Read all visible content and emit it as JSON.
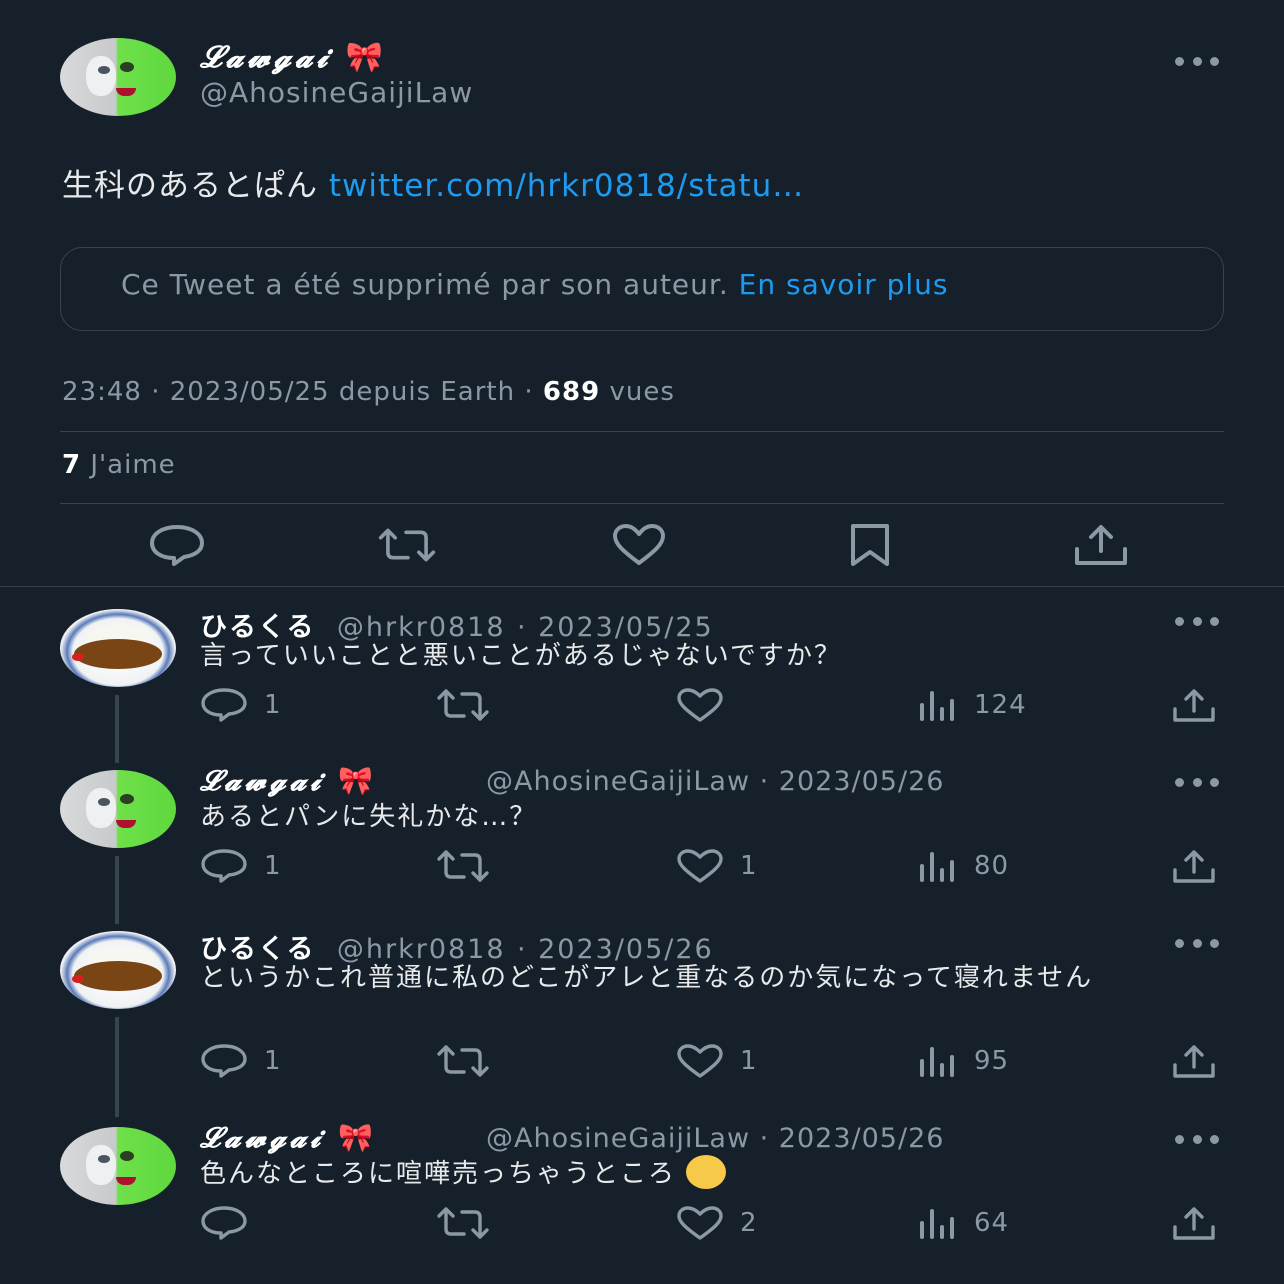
{
  "main": {
    "display_name": "𝓛𝓪𝔀𝓰𝓪𝓲",
    "bow": "🎀",
    "handle": "@AhosineGaijiLaw",
    "text": "生科のあるとぱん",
    "link": "twitter.com/hrkr0818/statu…",
    "deleted_notice": "Ce Tweet a été supprimé par son auteur.",
    "learn_more": "En savoir plus",
    "time": "23:48",
    "date": "2023/05/25",
    "source": "depuis Earth",
    "views_count": "689",
    "views_label": "vues",
    "likes_count": "7",
    "likes_label": "J'aime"
  },
  "replies": [
    {
      "name": "ひるくる",
      "handle": "@hrkr0818",
      "date": "· 2023/05/25",
      "text": "言っていいことと悪いことがあるじゃないですか？",
      "replies": "1",
      "likes": "",
      "views": "124"
    },
    {
      "name": "𝓛𝓪𝔀𝓰𝓪𝓲",
      "bow": "🎀",
      "handle": "@AhosineGaijiLaw",
      "date": "· 2023/05/26",
      "text": "あるとパンに失礼かな…？",
      "replies": "1",
      "likes": "1",
      "views": "80"
    },
    {
      "name": "ひるくる",
      "handle": "@hrkr0818",
      "date": "· 2023/05/26",
      "text": "というかこれ普通に私のどこがアレと重なるのか気になって寝れません",
      "replies": "1",
      "likes": "1",
      "views": "95"
    },
    {
      "name": "𝓛𝓪𝔀𝓰𝓪𝓲",
      "bow": "🎀",
      "handle": "@AhosineGaijiLaw",
      "date": "· 2023/05/26",
      "text": "色んなところに喧嘩売っちゃうところ",
      "replies": "",
      "likes": "2",
      "views": "64"
    }
  ],
  "colors": {
    "background": "#15202b",
    "link": "#1d9bf0",
    "muted": "#8b98a5",
    "border": "#38444d"
  },
  "icons": [
    "more-icon",
    "reply-icon",
    "retweet-icon",
    "like-icon",
    "bookmark-icon",
    "share-icon",
    "views-icon"
  ]
}
